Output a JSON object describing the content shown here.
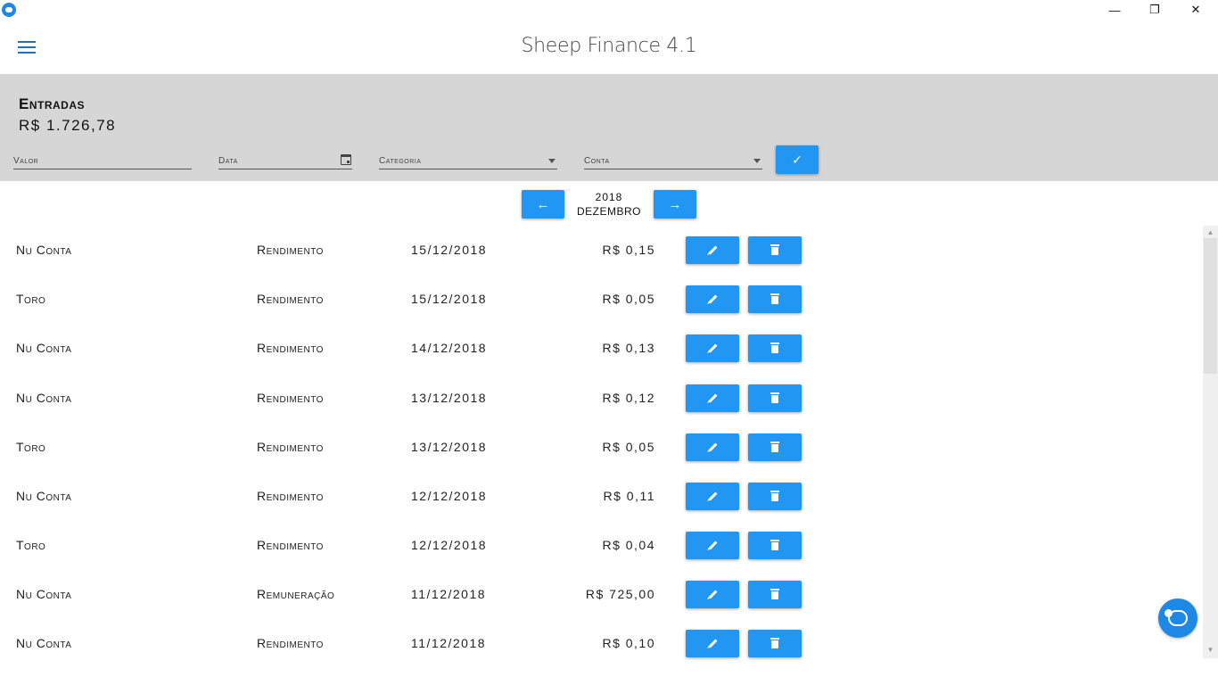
{
  "window": {
    "minimize": "—",
    "restore": "❐",
    "close": "✕"
  },
  "header": {
    "title": "Sheep Finance 4.1"
  },
  "summary": {
    "title": "Entradas",
    "total": "R$ 1.726,78"
  },
  "form": {
    "valor_label": "Valor",
    "data_label": "Data",
    "categoria_label": "Categoria",
    "conta_label": "Conta",
    "submit_icon": "✓"
  },
  "period": {
    "year": "2018",
    "month": "DEZEMBRO",
    "prev_icon": "←",
    "next_icon": "→"
  },
  "rows": [
    {
      "conta": "Nu Conta",
      "categoria": "Rendimento",
      "data": "15/12/2018",
      "valor": "R$ 0,15"
    },
    {
      "conta": "Toro",
      "categoria": "Rendimento",
      "data": "15/12/2018",
      "valor": "R$ 0,05"
    },
    {
      "conta": "Nu Conta",
      "categoria": "Rendimento",
      "data": "14/12/2018",
      "valor": "R$ 0,13"
    },
    {
      "conta": "Nu Conta",
      "categoria": "Rendimento",
      "data": "13/12/2018",
      "valor": "R$ 0,12"
    },
    {
      "conta": "Toro",
      "categoria": "Rendimento",
      "data": "13/12/2018",
      "valor": "R$ 0,05"
    },
    {
      "conta": "Nu Conta",
      "categoria": "Rendimento",
      "data": "12/12/2018",
      "valor": "R$ 0,11"
    },
    {
      "conta": "Toro",
      "categoria": "Rendimento",
      "data": "12/12/2018",
      "valor": "R$ 0,04"
    },
    {
      "conta": "Nu Conta",
      "categoria": "Remuneração",
      "data": "11/12/2018",
      "valor": "R$ 725,00"
    },
    {
      "conta": "Nu Conta",
      "categoria": "Rendimento",
      "data": "11/12/2018",
      "valor": "R$ 0,10"
    }
  ],
  "colors": {
    "accent": "#2196f3",
    "summary_bg": "#d6d6d6"
  }
}
